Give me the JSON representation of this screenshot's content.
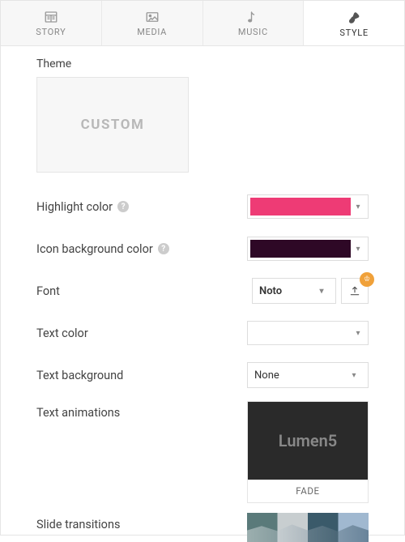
{
  "tabs": [
    {
      "id": "story",
      "label": "STORY"
    },
    {
      "id": "media",
      "label": "MEDIA"
    },
    {
      "id": "music",
      "label": "MUSIC"
    },
    {
      "id": "style",
      "label": "STYLE"
    }
  ],
  "activeTab": "style",
  "theme": {
    "label": "Theme",
    "selected": "CUSTOM"
  },
  "settings": {
    "highlight_color": {
      "label": "Highlight color",
      "value": "#ee3b75",
      "help": true
    },
    "icon_bg_color": {
      "label": "Icon background color",
      "value": "#2e0826",
      "help": true
    },
    "font": {
      "label": "Font",
      "value": "Noto",
      "upload": true,
      "premium": true
    },
    "text_color": {
      "label": "Text color",
      "value": "#ffffff"
    },
    "text_background": {
      "label": "Text background",
      "value": "None"
    },
    "text_animations": {
      "label": "Text animations",
      "preview_text": "Lumen5",
      "selected_label": "FADE",
      "bg": "#2a2a2a"
    },
    "slide_transitions": {
      "label": "Slide transitions"
    }
  }
}
